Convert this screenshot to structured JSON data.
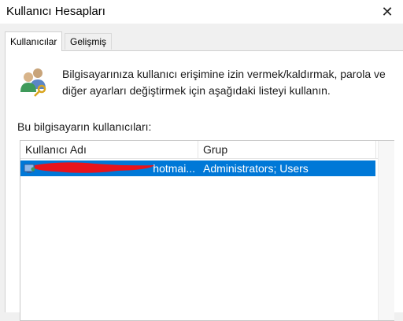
{
  "window": {
    "title": "Kullanıcı Hesapları",
    "close_glyph": "✕"
  },
  "tabs": [
    {
      "label": "Kullanıcılar",
      "active": true
    },
    {
      "label": "Gelişmiş",
      "active": false
    }
  ],
  "intro": {
    "icon": "users-key-icon",
    "text": "Bilgisayarınıza kullanıcı erişimine izin vermek/kaldırmak, parola ve diğer ayarları değiştirmek için aşağıdaki listeyi kullanın."
  },
  "users": {
    "label": "Bu bilgisayarın kullanıcıları:",
    "columns": {
      "name": "Kullanıcı Adı",
      "group": "Grup"
    },
    "rows": [
      {
        "name": "hotmai...",
        "group": "Administrators; Users",
        "selected": true
      }
    ]
  },
  "colors": {
    "selection": "#0078d7",
    "redaction": "#e8141c"
  }
}
